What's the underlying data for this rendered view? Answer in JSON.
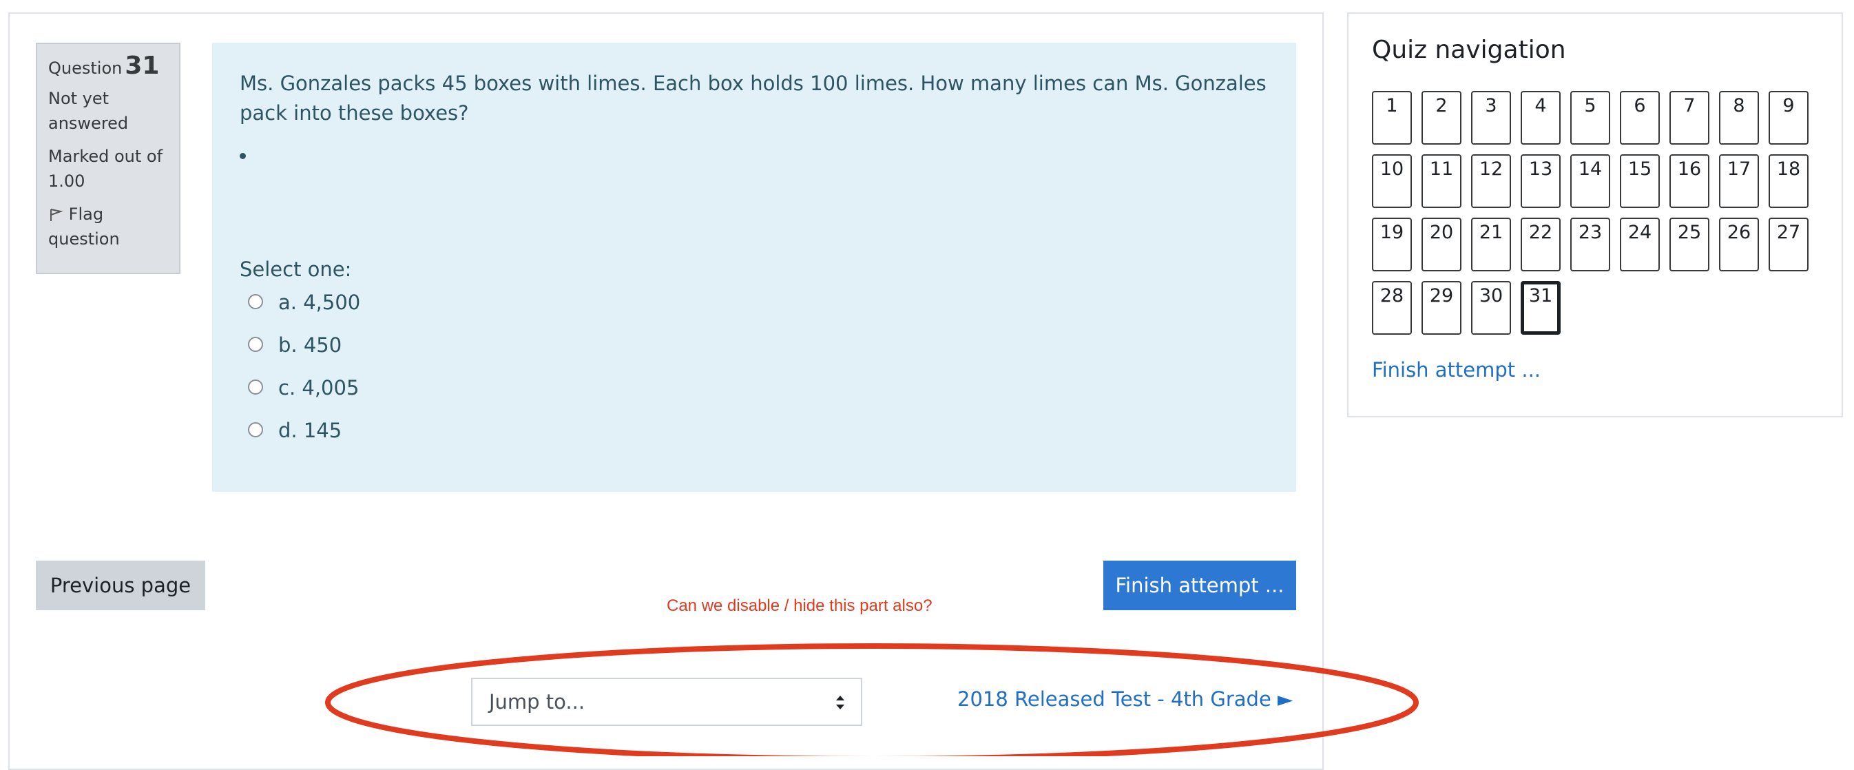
{
  "question_info": {
    "label": "Question",
    "number": "31",
    "state": "Not yet answered",
    "grade": "Marked out of 1.00",
    "flag_label": "Flag question"
  },
  "question": {
    "text": "Ms. Gonzales packs 45 boxes with limes. Each box holds 100 limes. How many limes can Ms. Gonzales pack into these boxes?",
    "prompt": "Select one:",
    "answers": [
      "a. 4,500",
      "b. 450",
      "c. 4,005",
      "d. 145"
    ]
  },
  "buttons": {
    "previous": "Previous page",
    "finish": "Finish attempt ..."
  },
  "annotation": "Can we disable / hide this part also?",
  "jump": {
    "label": "Jump to...",
    "next_link": "2018 Released Test - 4th Grade ►"
  },
  "nav": {
    "title": "Quiz navigation",
    "items": [
      "1",
      "2",
      "3",
      "4",
      "5",
      "6",
      "7",
      "8",
      "9",
      "10",
      "11",
      "12",
      "13",
      "14",
      "15",
      "16",
      "17",
      "18",
      "19",
      "20",
      "21",
      "22",
      "23",
      "24",
      "25",
      "26",
      "27",
      "28",
      "29",
      "30",
      "31"
    ],
    "current": "31",
    "finish": "Finish attempt ..."
  },
  "colors": {
    "accent": "#2d78d3",
    "link": "#1f6ec7",
    "annotation_red": "#e03a1f",
    "question_bg": "#e1f1f7"
  }
}
